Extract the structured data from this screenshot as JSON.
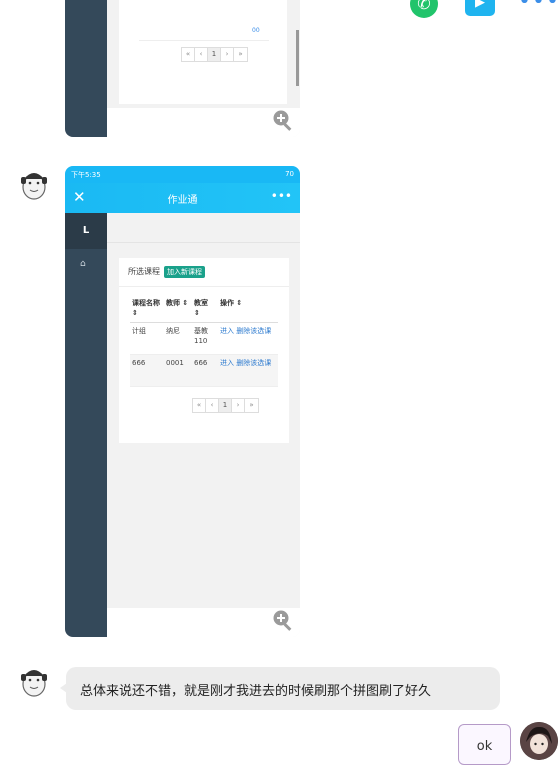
{
  "screenshot1": {
    "pagination": [
      "«",
      "‹",
      "1",
      "›",
      "»"
    ],
    "corner_text": "00"
  },
  "screenshot2": {
    "status_time": "下午5:35",
    "status_right": "70",
    "app_title": "作业通",
    "logo_letter": "L",
    "section_title": "所选课程",
    "add_button": "加入新课程",
    "table": {
      "headers": [
        "课程名称",
        "教师",
        "教室",
        "操作"
      ],
      "rows": [
        {
          "course": "计组",
          "teacher": "纳尼",
          "room": "基教110",
          "ops": "进入 删除该选课"
        },
        {
          "course": "666",
          "teacher": "0001",
          "room": "666",
          "ops": "进入 删除该选课"
        }
      ]
    },
    "pagination": [
      "«",
      "‹",
      "1",
      "›",
      "»"
    ]
  },
  "message": {
    "text": "总体来说还不错，就是刚才我进去的时候刷那个拼图刷了好久"
  },
  "sticker": {
    "text": "ok"
  },
  "colors": {
    "app_blue": "#19b8f5",
    "sidebar": "#34495a",
    "add_button": "#1aa18b",
    "link": "#2e7bcf"
  }
}
